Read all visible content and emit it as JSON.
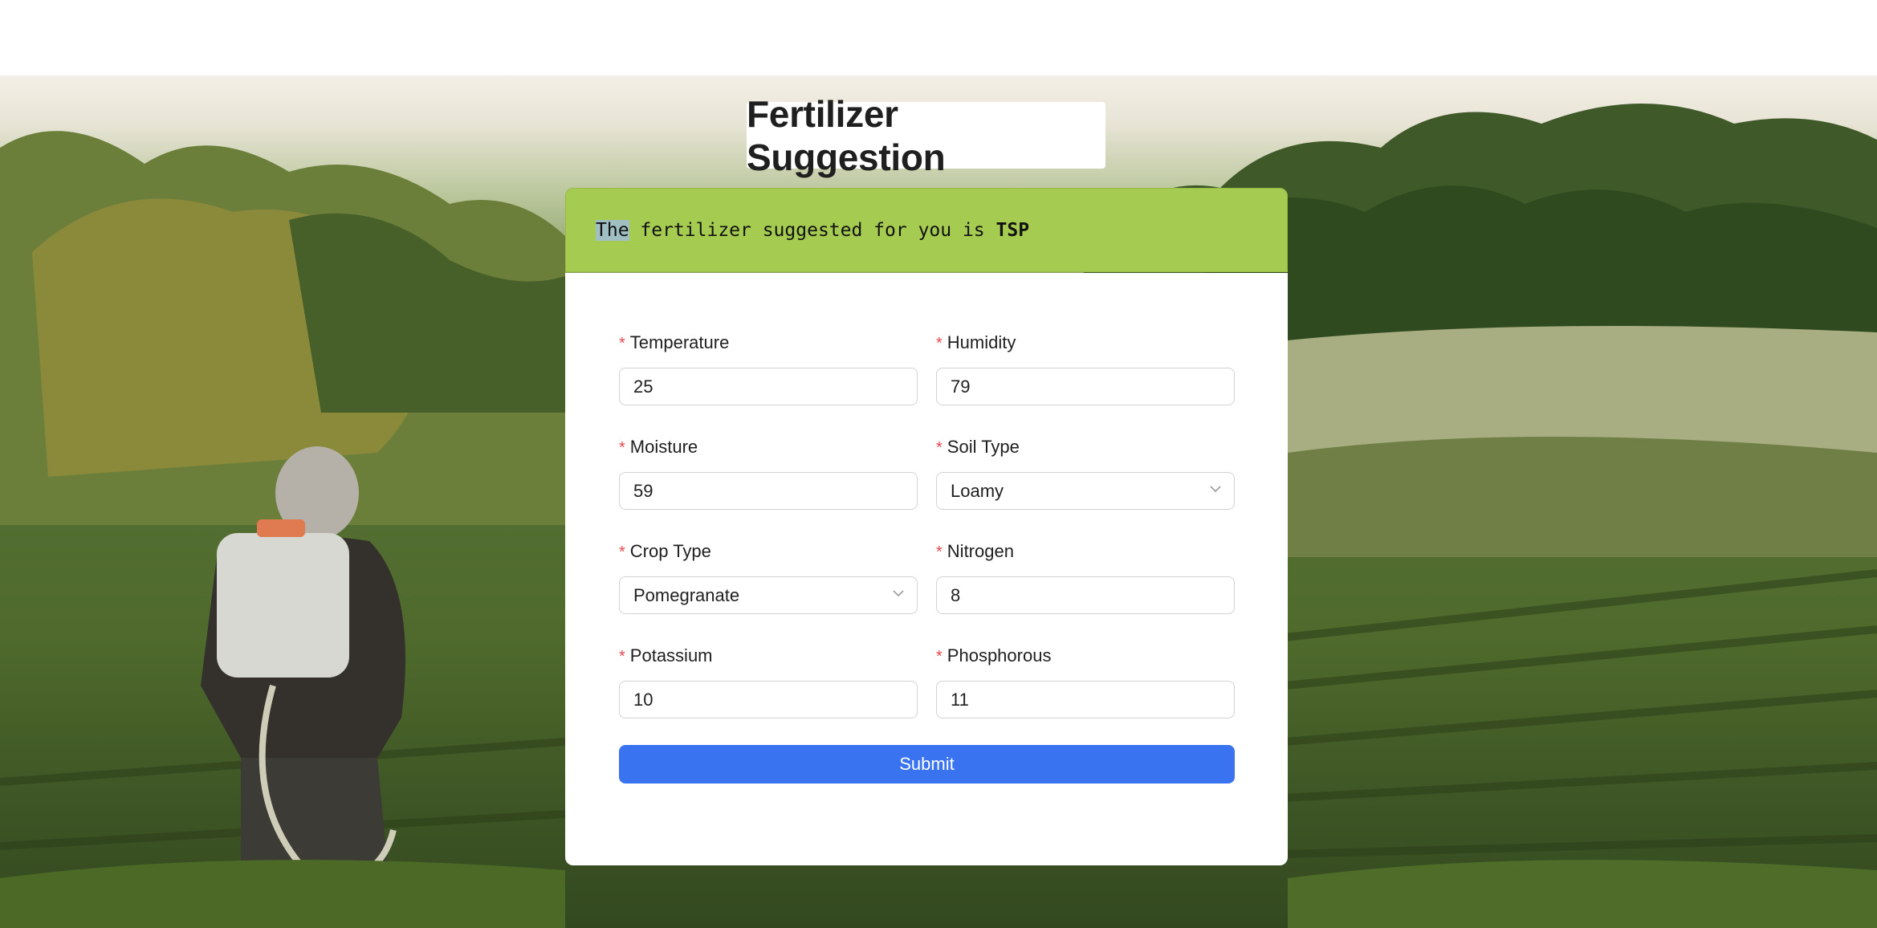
{
  "page": {
    "title": "Fertilizer Suggestion",
    "accent_color": "#3a73f0",
    "result_bg_color": "#a5cc50"
  },
  "result": {
    "prefix_highlight": "The",
    "text": " fertilizer suggested for you is ",
    "fertilizer": "TSP"
  },
  "form": {
    "temperature": {
      "label": "Temperature",
      "value": "25"
    },
    "humidity": {
      "label": "Humidity",
      "value": "79"
    },
    "moisture": {
      "label": "Moisture",
      "value": "59"
    },
    "soil_type": {
      "label": "Soil Type",
      "value": "Loamy",
      "icon": "chevron-down-icon"
    },
    "crop_type": {
      "label": "Crop Type",
      "value": "Pomegranate",
      "icon": "chevron-down-icon"
    },
    "nitrogen": {
      "label": "Nitrogen",
      "value": "8"
    },
    "potassium": {
      "label": "Potassium",
      "value": "10"
    },
    "phosphorous": {
      "label": "Phosphorous",
      "value": "11"
    },
    "required_marker": "*",
    "submit_label": "Submit"
  }
}
